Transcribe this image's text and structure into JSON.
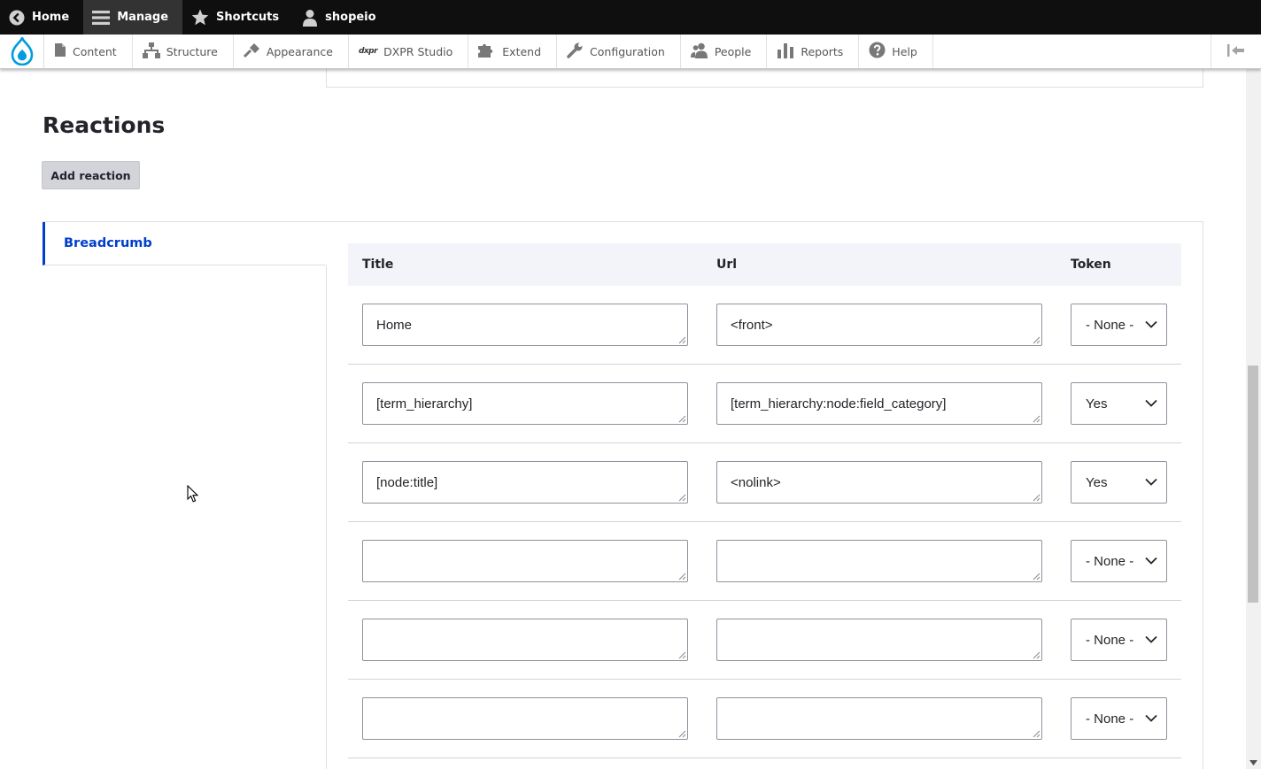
{
  "toolbar": {
    "home_label": "Home",
    "manage_label": "Manage",
    "shortcuts_label": "Shortcuts",
    "user_label": "shopeio"
  },
  "tray": {
    "items": [
      {
        "label": "Content",
        "icon": "file-icon"
      },
      {
        "label": "Structure",
        "icon": "sitemap-icon"
      },
      {
        "label": "Appearance",
        "icon": "paintbrush-icon"
      },
      {
        "label": "DXPR Studio",
        "icon": "dxpr-logo"
      },
      {
        "label": "Extend",
        "icon": "puzzle-icon"
      },
      {
        "label": "Configuration",
        "icon": "wrench-icon"
      },
      {
        "label": "People",
        "icon": "people-icon"
      },
      {
        "label": "Reports",
        "icon": "bar-chart-icon"
      },
      {
        "label": "Help",
        "icon": "help-icon"
      }
    ],
    "dxpr_mark": "dxpr"
  },
  "reactions": {
    "title": "Reactions",
    "add_button": "Add reaction"
  },
  "vertical_tabs": {
    "active": "Breadcrumb"
  },
  "breadcrumb_table": {
    "headers": {
      "title": "Title",
      "url": "Url",
      "token": "Token"
    },
    "rows": [
      {
        "title": "Home",
        "url": "<front>",
        "token": "- None -"
      },
      {
        "title": "[term_hierarchy]",
        "url": "[term_hierarchy:node:field_category]",
        "token": "Yes"
      },
      {
        "title": "[node:title]",
        "url": "<nolink>",
        "token": "Yes"
      },
      {
        "title": "",
        "url": "",
        "token": "- None -"
      },
      {
        "title": "",
        "url": "",
        "token": "- None -"
      },
      {
        "title": "",
        "url": "",
        "token": "- None -"
      }
    ]
  },
  "colors": {
    "toolbar_bg": "#0f0f0f",
    "accent_blue": "#003ecc",
    "drupal_blue": "#009cde",
    "table_header_bg": "#f3f4f9"
  }
}
